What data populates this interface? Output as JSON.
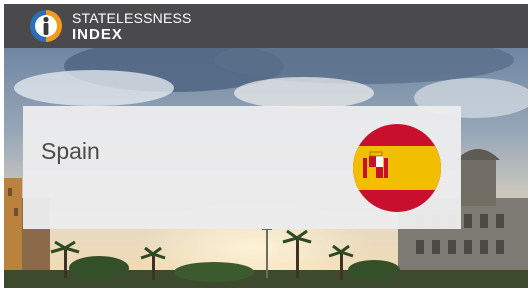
{
  "header": {
    "logo_line1": "STATELESSNESS",
    "logo_line2": "INDEX",
    "logo_icon": "person-in-circle-logo-icon"
  },
  "card": {
    "country": "Spain",
    "flag_icon": "spain-flag-icon"
  },
  "colors": {
    "topbar": "#4a4a4c",
    "logo_blue": "#2c6fb7",
    "logo_orange": "#f39a1c",
    "card_bg": "#ececed",
    "card_text": "#4b4b4b",
    "flag_red": "#c8102e",
    "flag_yellow": "#f1bf00"
  }
}
